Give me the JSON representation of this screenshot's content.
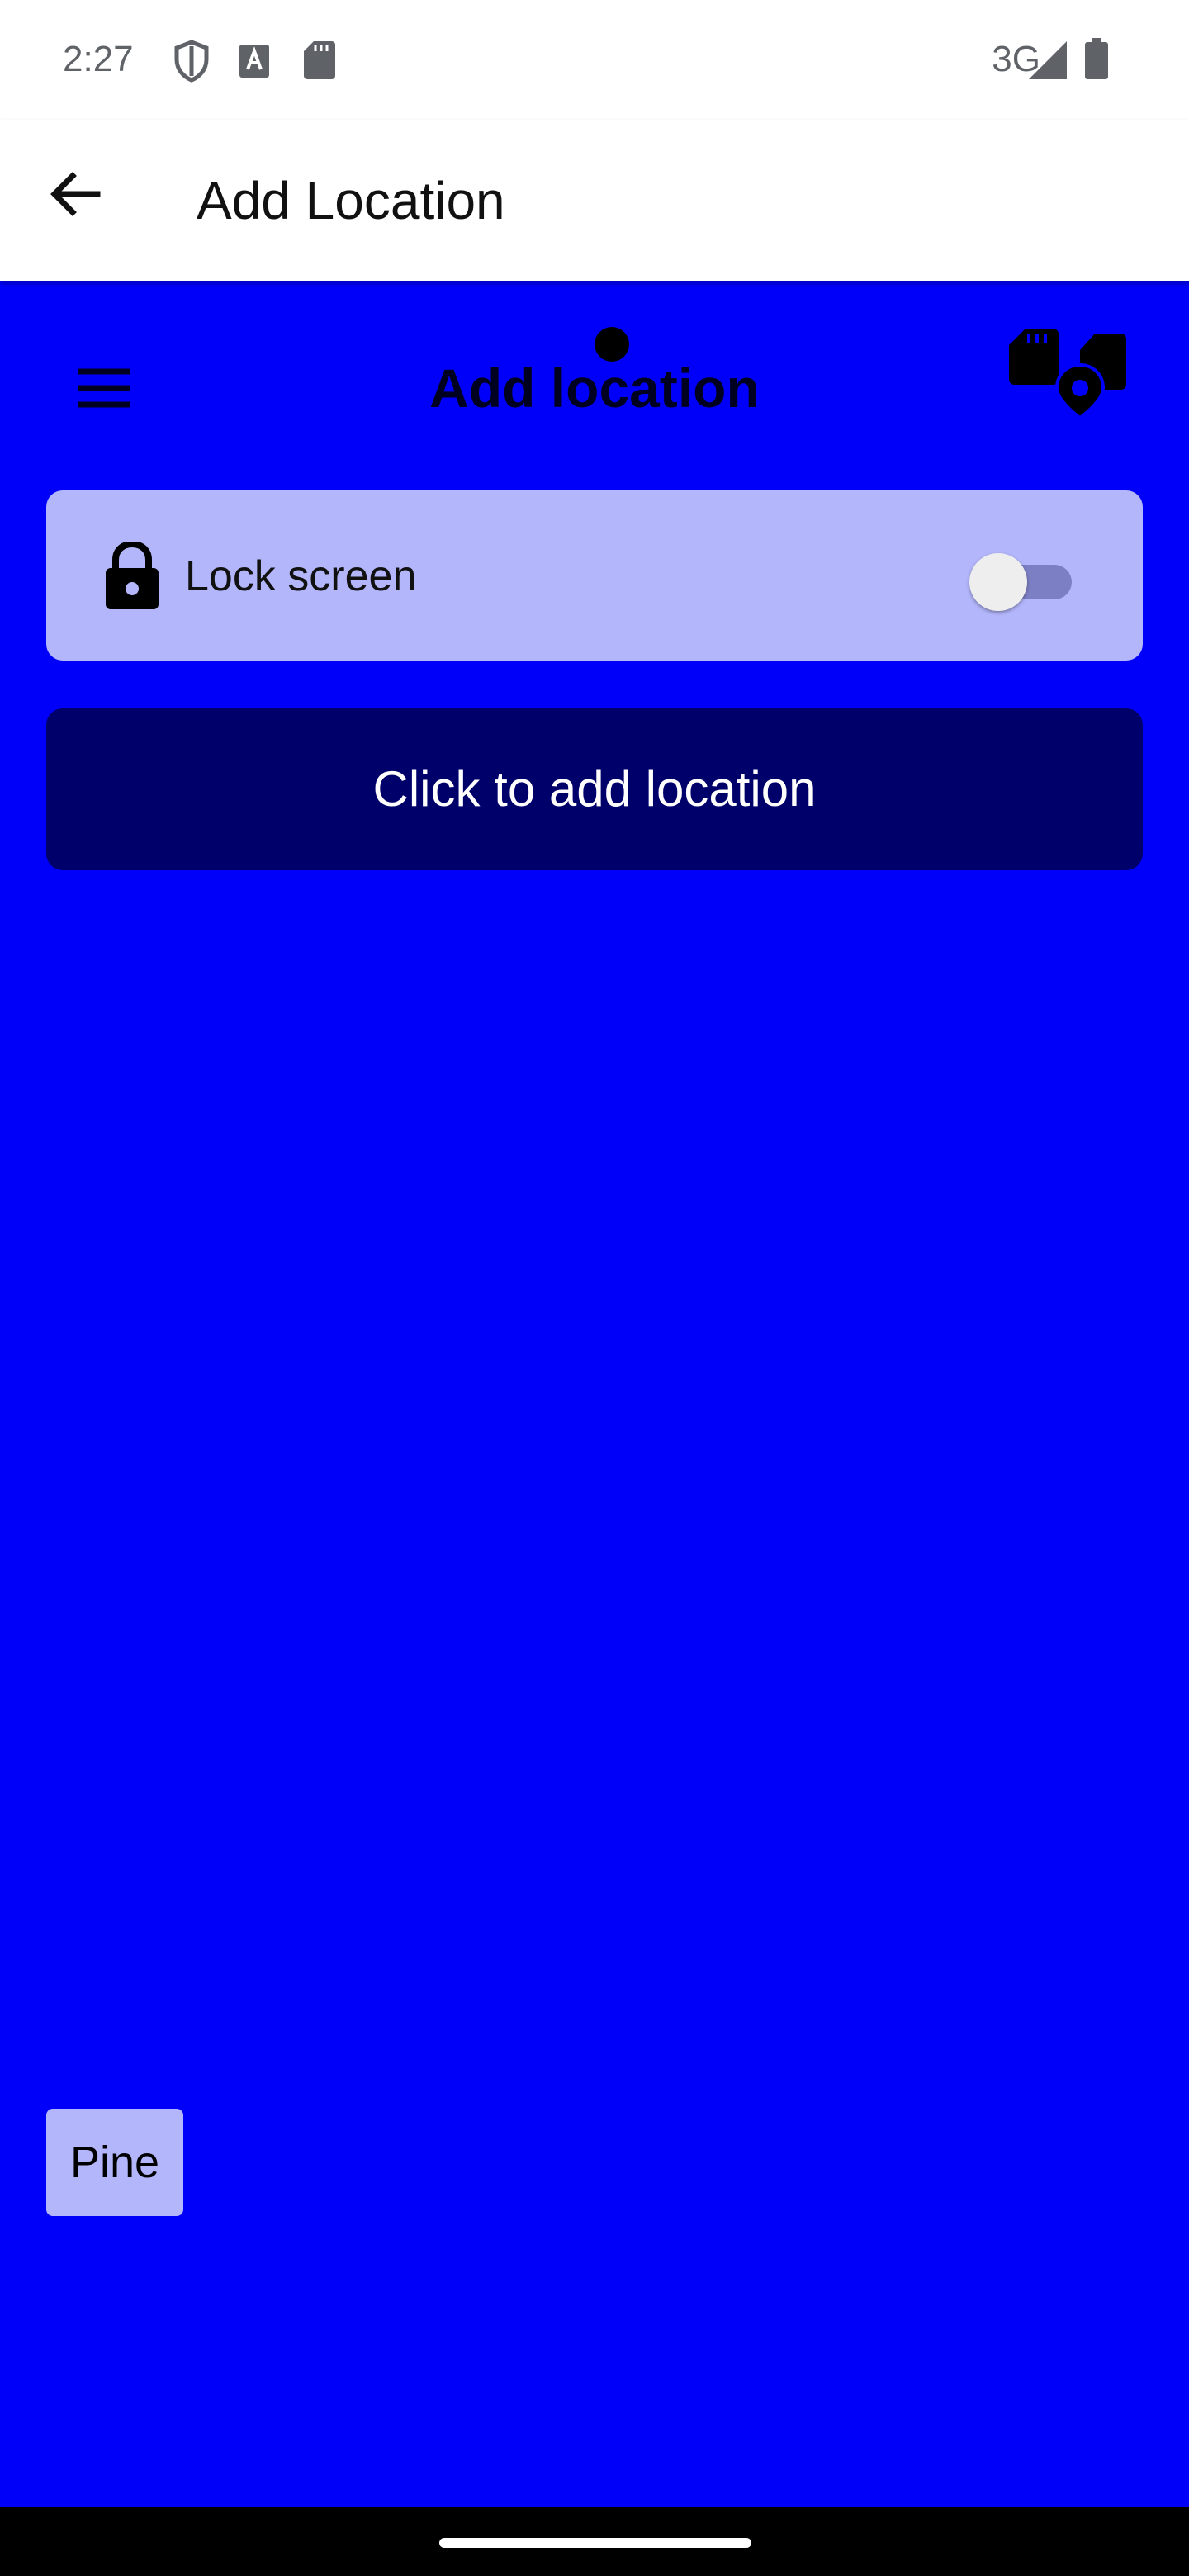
{
  "status_bar": {
    "time": "2:27",
    "network": "3G",
    "icons": [
      "shield-icon",
      "font-a-icon",
      "sd-card-icon",
      "signal-icon",
      "battery-icon"
    ]
  },
  "app_bar": {
    "title": "Add Location",
    "back_icon": "arrow-back-icon"
  },
  "content": {
    "title": "Add location",
    "menu_icon": "hamburger-menu-icon",
    "header_icon": "sd-card-location-icon",
    "lock_card": {
      "label": "Lock screen",
      "icon": "lock-icon",
      "toggle_on": false
    },
    "add_button_label": "Click to add location",
    "chip_label": "Pine"
  },
  "colors": {
    "background": "#0000fa",
    "card": "#b3b6fb",
    "button": "#00006a",
    "app_bar": "#ffffff"
  }
}
